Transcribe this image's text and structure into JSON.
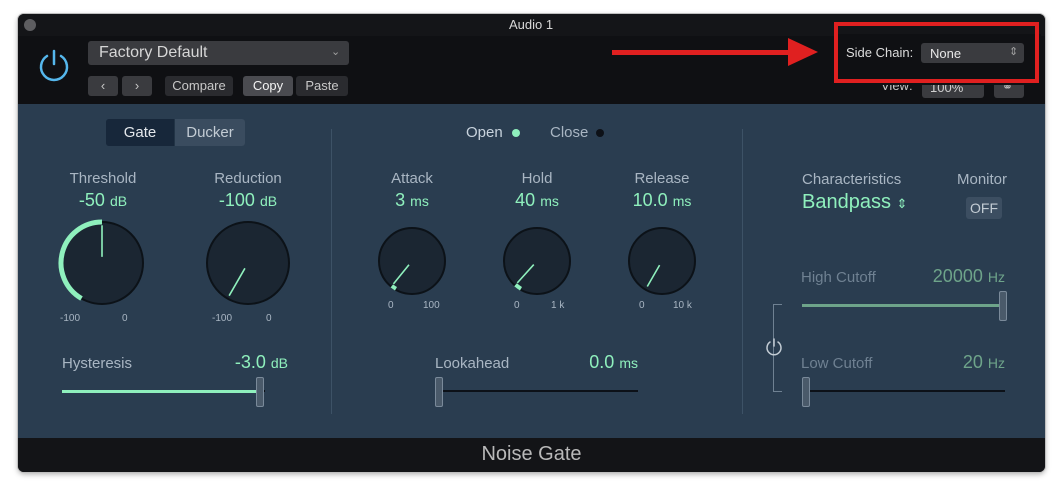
{
  "window": {
    "title": "Audio 1"
  },
  "header": {
    "preset": "Factory Default",
    "compare": "Compare",
    "copy": "Copy",
    "paste": "Paste",
    "sidechain_label": "Side Chain:",
    "sidechain_value": "None",
    "view_label": "View:",
    "view_value": "100%"
  },
  "mode": {
    "gate": "Gate",
    "ducker": "Ducker"
  },
  "knobs": {
    "threshold": {
      "label": "Threshold",
      "value": "-50",
      "unit": "dB",
      "min": "-100",
      "max": "0",
      "level": 0.5
    },
    "reduction": {
      "label": "Reduction",
      "value": "-100",
      "unit": "dB",
      "min": "-100",
      "max": "0",
      "level": 0.0
    },
    "attack": {
      "label": "Attack",
      "value": "3",
      "unit": "ms",
      "min": "0",
      "max": "100",
      "level": 0.03
    },
    "hold": {
      "label": "Hold",
      "value": "40",
      "unit": "ms",
      "min": "0",
      "max": "1 k",
      "level": 0.04
    },
    "release": {
      "label": "Release",
      "value": "10.0",
      "unit": "ms",
      "min": "0",
      "max": "10 k",
      "level": 0.0
    }
  },
  "hysteresis": {
    "label": "Hysteresis",
    "value": "-3.0",
    "unit": "dB",
    "level": 0.97
  },
  "open_close": {
    "open": "Open",
    "close": "Close"
  },
  "lookahead": {
    "label": "Lookahead",
    "value": "0.0",
    "unit": "ms",
    "level": 0.0
  },
  "characteristics": {
    "label": "Characteristics",
    "value": "Bandpass"
  },
  "monitor": {
    "label": "Monitor",
    "value": "OFF"
  },
  "high_cutoff": {
    "label": "High Cutoff",
    "value": "20000",
    "unit": "Hz",
    "level": 1.0
  },
  "low_cutoff": {
    "label": "Low Cutoff",
    "value": "20",
    "unit": "Hz",
    "level": 0.0
  },
  "footer": {
    "title": "Noise Gate"
  },
  "colors": {
    "accent": "#8ff0bd",
    "panel": "#2a3d50",
    "highlight": "#e02020"
  }
}
